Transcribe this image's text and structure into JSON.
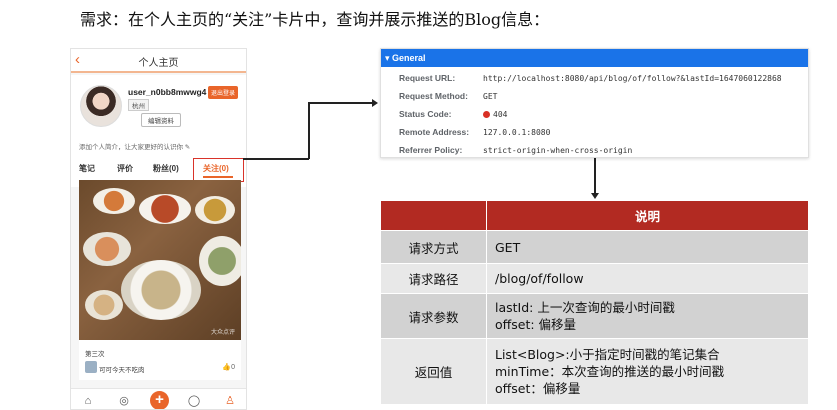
{
  "heading": "需求：在个人主页的“关注”卡片中，查询并展示推送的Blog信息：",
  "phone": {
    "title": "个人主页",
    "username": "user_n0bb8mwwg4",
    "logout": "退出登录",
    "city": "杭州",
    "edit": "编辑资料",
    "intro": "添加个人简介，让大家更好的认识你 ✎",
    "tabs": [
      "笔记",
      "评价",
      "粉丝(0)",
      "关注(0)"
    ],
    "card_title": "第三次",
    "card_author": "可可今天不吃肉",
    "card_likes": "0",
    "watermark": "大众点评"
  },
  "devtools": {
    "section": "▾ General",
    "rows": [
      {
        "key": "Request URL:",
        "value": "http://localhost:8080/api/blog/of/follow?&lastId=1647060122868"
      },
      {
        "key": "Request Method:",
        "value": "GET"
      },
      {
        "key": "Status Code:",
        "value": "404"
      },
      {
        "key": "Remote Address:",
        "value": "127.0.0.1:8080"
      },
      {
        "key": "Referrer Policy:",
        "value": "strict-origin-when-cross-origin"
      }
    ]
  },
  "spec_table": {
    "header": "说明",
    "rows": [
      {
        "label": "请求方式",
        "lines": [
          "GET"
        ]
      },
      {
        "label": "请求路径",
        "lines": [
          "/blog/of/follow"
        ]
      },
      {
        "label": "请求参数",
        "lines": [
          "lastId: 上一次查询的最小时间戳",
          "offset: 偏移量"
        ]
      },
      {
        "label": "返回值",
        "lines": [
          "List<Blog>:小于指定时间戳的笔记集合",
          "minTime：本次查询的推送的最小时间戳",
          "offset：偏移量"
        ]
      }
    ]
  },
  "colors": {
    "accent": "#e9652a",
    "table_header": "#b22a22",
    "devtools_blue": "#1a73e8",
    "status_red": "#d93025"
  }
}
